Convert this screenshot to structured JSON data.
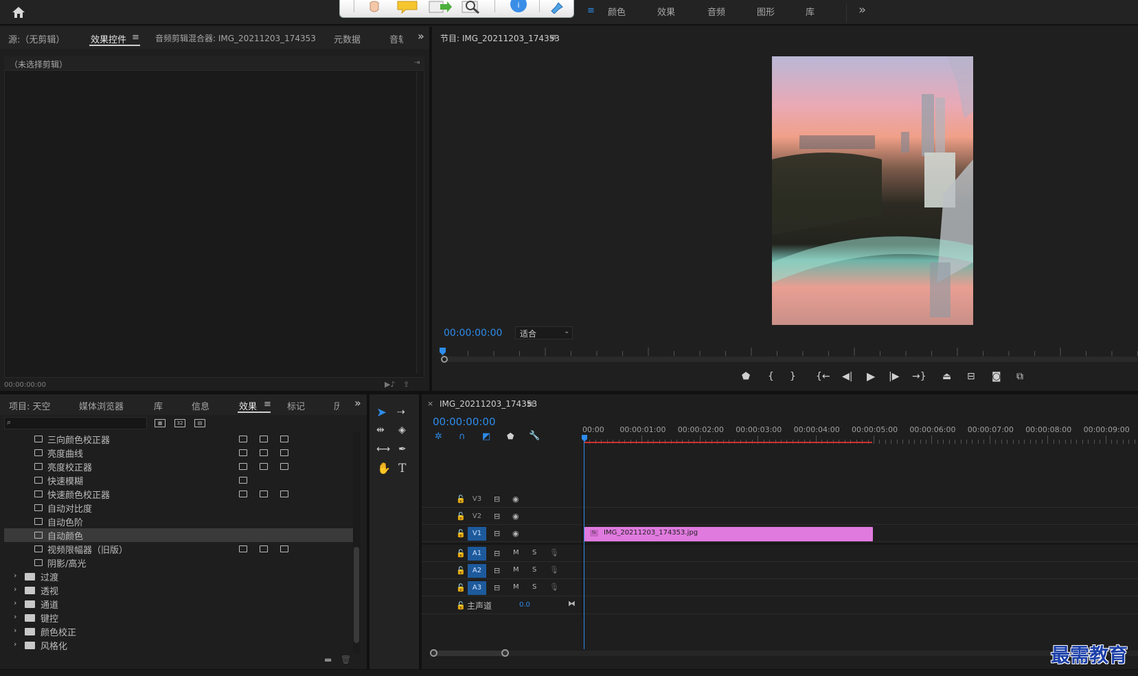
{
  "workspace_tabs": [
    "颜色",
    "效果",
    "音频",
    "图形",
    "库"
  ],
  "source_panel": {
    "tabs": [
      "源:（无剪辑）",
      "效果控件",
      "音频剪辑混合器: IMG_20211203_174353",
      "元数据",
      "音轨"
    ],
    "header": "（未选择剪辑）",
    "timecode": "00:00:00:00"
  },
  "program_panel": {
    "title": "节目: IMG_20211203_174353",
    "timecode": "00:00:00:00",
    "fit_label": "适合"
  },
  "project_panel": {
    "tabs": [
      "项目: 天空",
      "媒体浏览器",
      "库",
      "信息",
      "效果",
      "标记",
      "历史"
    ],
    "search_placeholder": "",
    "effects": [
      {
        "name": "三向颜色校正器",
        "type": "effect",
        "badges": 3,
        "selected": false
      },
      {
        "name": "亮度曲线",
        "type": "effect",
        "badges": 3,
        "selected": false
      },
      {
        "name": "亮度校正器",
        "type": "effect",
        "badges": 3,
        "selected": false
      },
      {
        "name": "快速模糊",
        "type": "effect",
        "badges": 1,
        "selected": false
      },
      {
        "name": "快速颜色校正器",
        "type": "effect",
        "badges": 3,
        "selected": false
      },
      {
        "name": "自动对比度",
        "type": "effect",
        "badges": 0,
        "selected": false
      },
      {
        "name": "自动色阶",
        "type": "effect",
        "badges": 0,
        "selected": false
      },
      {
        "name": "自动颜色",
        "type": "effect",
        "badges": 0,
        "selected": true
      },
      {
        "name": "视频限幅器（旧版）",
        "type": "effect",
        "badges": 3,
        "selected": false
      },
      {
        "name": "阴影/高光",
        "type": "effect",
        "badges": 0,
        "selected": false
      },
      {
        "name": "过渡",
        "type": "folder",
        "badges": 0,
        "selected": false
      },
      {
        "name": "透视",
        "type": "folder",
        "badges": 0,
        "selected": false
      },
      {
        "name": "通道",
        "type": "folder",
        "badges": 0,
        "selected": false
      },
      {
        "name": "键控",
        "type": "folder",
        "badges": 0,
        "selected": false
      },
      {
        "name": "颜色校正",
        "type": "folder",
        "badges": 0,
        "selected": false
      },
      {
        "name": "风格化",
        "type": "folder",
        "badges": 0,
        "selected": false
      }
    ]
  },
  "timeline": {
    "sequence_name": "IMG_20211203_174353",
    "timecode": "00:00:00:00",
    "ruler": [
      "00:00",
      "00:00:01:00",
      "00:00:02:00",
      "00:00:03:00",
      "00:00:04:00",
      "00:00:05:00",
      "00:00:06:00",
      "00:00:07:00",
      "00:00:08:00",
      "00:00:09:00"
    ],
    "video_tracks": [
      "V3",
      "V2",
      "V1"
    ],
    "audio_tracks": [
      "A1",
      "A2",
      "A3"
    ],
    "audio_buttons": {
      "mute": "M",
      "solo": "S"
    },
    "master_label": "主声道",
    "master_value": "0.0",
    "clip_name": "IMG_20211203_174353.jpg",
    "clip_fx": "fx"
  },
  "watermark": "最需教育",
  "colors": {
    "accent_blue": "#2d8ceb",
    "clip_pink": "#e07adf",
    "selected_track": "#1d5a9c",
    "work_area_red": "#d03030"
  }
}
